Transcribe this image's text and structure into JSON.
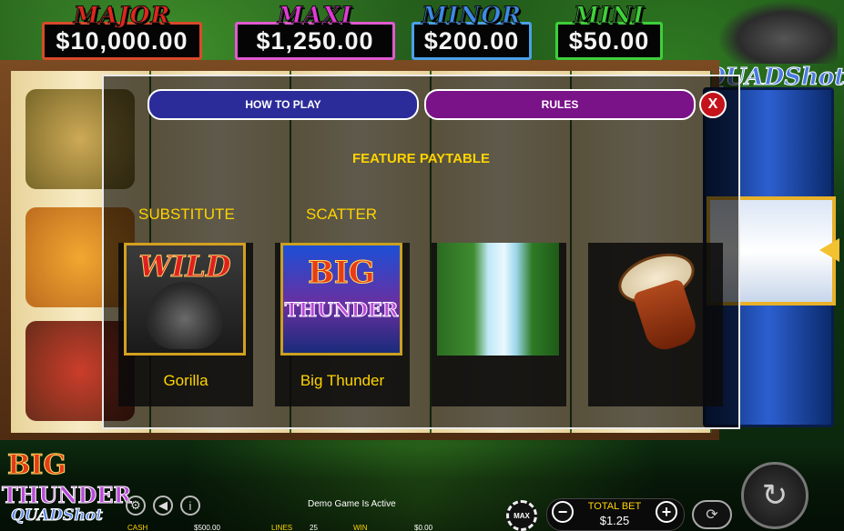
{
  "jackpots": [
    {
      "name": "MAJOR",
      "amount": "$10,000.00",
      "title_color": "#e0261c",
      "border_color": "#d94a2a"
    },
    {
      "name": "MAXI",
      "amount": "$1,250.00",
      "title_color": "#e23ad6",
      "border_color": "#e05ad0"
    },
    {
      "name": "MINOR",
      "amount": "$200.00",
      "title_color": "#3d8be8",
      "border_color": "#4aa0e8"
    },
    {
      "name": "MINI",
      "amount": "$50.00",
      "title_color": "#3fd33a",
      "border_color": "#3fcf3a"
    }
  ],
  "brand": {
    "corner_logo": "QUADShot",
    "bottom_logo_big": "BIG",
    "bottom_logo_thunder": "THUNDER",
    "bottom_logo_quad": "QUADShot"
  },
  "paytable": {
    "tabs": [
      {
        "label": "HOW TO PLAY",
        "color": "#2b2b9a"
      },
      {
        "label": "RULES",
        "color": "#7a1288"
      }
    ],
    "close_label": "X",
    "heading": "FEATURE PAYTABLE",
    "category_labels": [
      "SUBSTITUTE",
      "SCATTER"
    ],
    "symbols": [
      {
        "name": "Gorilla",
        "image_text": "WILD",
        "icon": "gorilla-wild-icon"
      },
      {
        "name": "Big Thunder",
        "image_text_1": "BIG",
        "image_text_2": "THUNDER",
        "icon": "big-thunder-scatter-icon"
      },
      {
        "name": "",
        "icon": "waterfall-icon"
      },
      {
        "name": "",
        "icon": "drum-icon"
      }
    ],
    "accent_color": "#ffd400"
  },
  "bottom_bar": {
    "settings_icon": "gear-icon",
    "sound_icon": "speaker-icon",
    "info_icon": "info-icon",
    "demo_text": "Demo Game Is Active",
    "cash_label": "CASH",
    "cash_value": "$500.00",
    "lines_label": "LINES",
    "lines_value": "25",
    "win_label": "WIN",
    "win_value": "$0.00",
    "max_label": "MAX",
    "total_bet_label": "TOTAL BET",
    "total_bet_value": "$1.25",
    "minus_label": "−",
    "plus_label": "+"
  }
}
